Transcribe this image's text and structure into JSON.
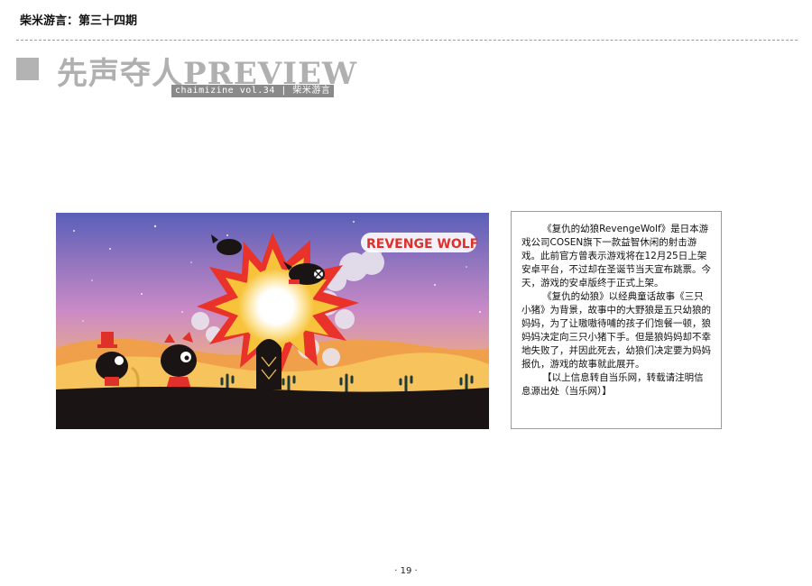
{
  "header": {
    "issue": "柴米游言：第三十四期"
  },
  "section": {
    "title": "先声夺人PREVIEW",
    "tag": "chaimizine vol.34  |  柴米游言"
  },
  "artwork": {
    "logo_text": "REVENGE WOLF",
    "colors": {
      "sky_top": "#5a5fb8",
      "sky_mid": "#c98ac6",
      "sky_low": "#f3b27a",
      "ground": "#1a1414",
      "explosion_outer": "#e8322a",
      "explosion_inner": "#f7c33a",
      "logo_red": "#e0302a"
    }
  },
  "article": {
    "paragraphs": [
      "《复仇的幼狼RevengeWolf》是日本游戏公司COSEN旗下一款益智休闲的射击游戏。此前官方曾表示游戏将在12月25日上架安卓平台，不过却在圣诞节当天宣布跳票。今天，游戏的安卓版终于正式上架。",
      "《复仇的幼狼》以经典童话故事《三只小猪》为背景，故事中的大野狼是五只幼狼的妈妈，为了让嗷嗷待哺的孩子们饱餐一顿，狼妈妈决定向三只小猪下手。但是狼妈妈却不幸地失败了，并因此死去，幼狼们决定要为妈妈报仇，游戏的故事就此展开。",
      "【以上信息转自当乐网，转载请注明信息源出处（当乐网）】"
    ]
  },
  "footer": {
    "page": "· 19 ·"
  }
}
